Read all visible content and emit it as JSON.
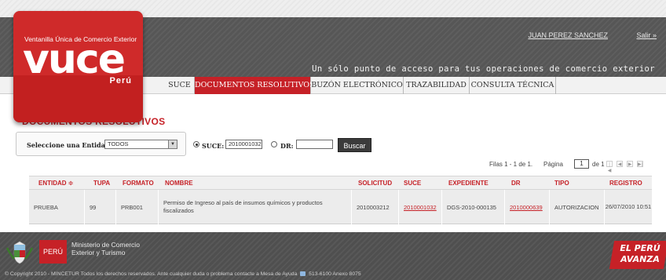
{
  "header": {
    "user_name": "JUAN PEREZ SANCHEZ",
    "logout_label": "Salir »",
    "tagline": "Un sólo punto de acceso para tus operaciones de comercio exterior"
  },
  "logo": {
    "subtitle": "Ventanilla Única de Comercio Exterior",
    "brand": "vuce",
    "country": "Perú"
  },
  "nav": {
    "tabs": [
      {
        "label": "SUCE",
        "active": false
      },
      {
        "label": "DOCUMENTOS RESOLUTIVOS",
        "active": true
      },
      {
        "label": "BUZÓN ELECTRÓNICO",
        "active": false
      },
      {
        "label": "TRAZABILIDAD",
        "active": false
      },
      {
        "label": "CONSULTA TÉCNICA",
        "active": false
      }
    ]
  },
  "main": {
    "title": "DOCUMENTOS RESOLUTIVOS",
    "entity_label": "Seleccione una Entidad:",
    "entity_value": "TODOS",
    "suce_label": "SUCE:",
    "suce_value": "2010001032",
    "dr_label": "DR:",
    "dr_value": "",
    "search_button": "Buscar"
  },
  "pagination": {
    "rows_text": "Filas 1 - 1 de 1.",
    "page_label": "Página",
    "page_value": "1",
    "of_text": "de 1"
  },
  "table": {
    "headers": [
      "ENTIDAD ≑",
      "TUPA",
      "FORMATO",
      "NOMBRE",
      "SOLICITUD",
      "SUCE",
      "EXPEDIENTE",
      "DR",
      "TIPO",
      "REGISTRO"
    ],
    "rows": [
      {
        "entidad": "PRUEBA",
        "tupa": "99",
        "formato": "PRB001",
        "nombre": "Permiso de Ingreso al país de insumos químicos y productos fiscalizados",
        "solicitud": "2010003212",
        "suce": "2010001032",
        "expediente": "DGS-2010-000135",
        "dr": "2010000639",
        "tipo": "AUTORIZACION",
        "registro": "26/07/2010 10:51"
      }
    ]
  },
  "footer": {
    "peru_label": "PERÚ",
    "ministry": "Ministerio de Comercio Exterior y Turismo",
    "copyright_pre": "© Copyright 2010 - MINCETUR Todos los derechos reservados. Ante cualquier duda o problema contacte a Mesa de Ayuda",
    "copyright_post": "513-6100 Anexo 8075",
    "avanza": "EL PERÚ AVANZA"
  }
}
